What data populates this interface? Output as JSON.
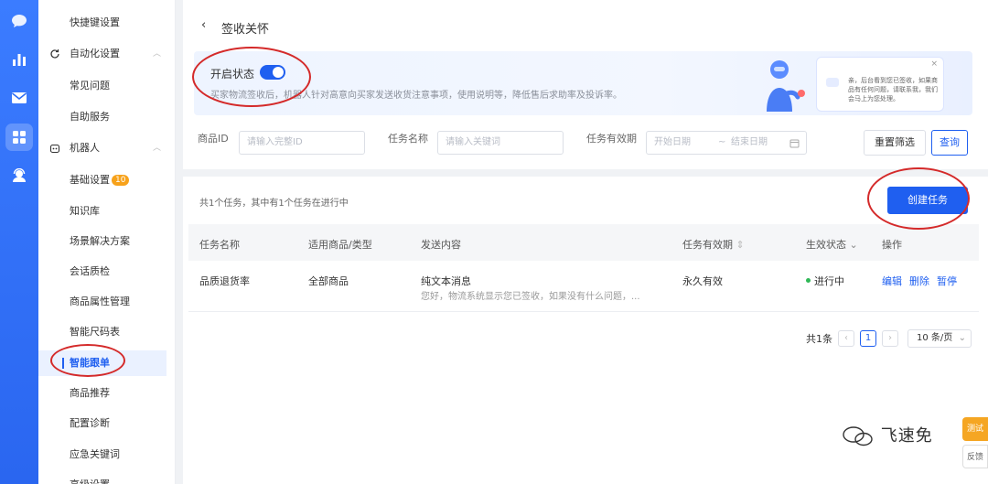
{
  "rail": {
    "items": [
      {
        "icon": "chat-bubble-icon"
      },
      {
        "icon": "bar-chart-icon"
      },
      {
        "icon": "mail-icon"
      },
      {
        "icon": "apps-grid-icon"
      },
      {
        "icon": "headset-agent-icon"
      }
    ]
  },
  "sidebar": {
    "items": [
      {
        "label": "快捷键设置"
      },
      {
        "label": "自动化设置"
      },
      {
        "label": "常见问题"
      },
      {
        "label": "自助服务"
      },
      {
        "label": "机器人"
      },
      {
        "label": "基础设置",
        "badge": "10"
      },
      {
        "label": "知识库"
      },
      {
        "label": "场景解决方案"
      },
      {
        "label": "会话质检"
      },
      {
        "label": "商品属性管理"
      },
      {
        "label": "智能尺码表"
      },
      {
        "label": "智能跟单"
      },
      {
        "label": "商品推荐"
      },
      {
        "label": "配置诊断"
      },
      {
        "label": "应急关键词"
      },
      {
        "label": "高级设置"
      }
    ]
  },
  "header": {
    "back_icon": "chevron-left-icon",
    "title": "签收关怀"
  },
  "banner": {
    "toggle_label": "开启状态",
    "toggle_on": true,
    "description": "买家物流签收后，机器人针对高意向买家发送收货注意事项，使用说明等，降低售后求助率及投诉率。",
    "chat_text": "亲，后台看到您已签收，如果商品有任何问题，请联系我，我们会马上为您处理。"
  },
  "filters": {
    "product_id_label": "商品ID",
    "product_id_placeholder": "请输入完整ID",
    "task_name_label": "任务名称",
    "task_name_placeholder": "请输入关键词",
    "validity_label": "任务有效期",
    "start_placeholder": "开始日期",
    "end_placeholder": "结束日期",
    "reset_label": "重置筛选",
    "query_label": "查询"
  },
  "main": {
    "summary": "共1个任务，其中有1个任务在进行中",
    "create_label": "创建任务"
  },
  "table": {
    "headers": [
      "任务名称",
      "适用商品/类型",
      "发送内容",
      "任务有效期",
      "生效状态",
      "操作"
    ],
    "rows": [
      {
        "name": "品质退货率",
        "scope": "全部商品",
        "content_type": "纯文本消息",
        "content_preview": "您好，物流系统显示您已签收，如果没有什么问题，...",
        "validity": "永久有效",
        "status": "进行中",
        "actions": [
          "编辑",
          "删除",
          "暂停"
        ]
      }
    ]
  },
  "pagination": {
    "total": "共1条",
    "current": "1",
    "page_size": "10 条/页"
  },
  "watermark": "飞速免",
  "side_tabs": [
    "测试",
    "反馈"
  ],
  "colors": {
    "primary": "#1f5ff0",
    "rail": "#2f6ff5",
    "annotation": "#d42a2a",
    "success": "#30b857",
    "badge": "#f7a21b"
  }
}
